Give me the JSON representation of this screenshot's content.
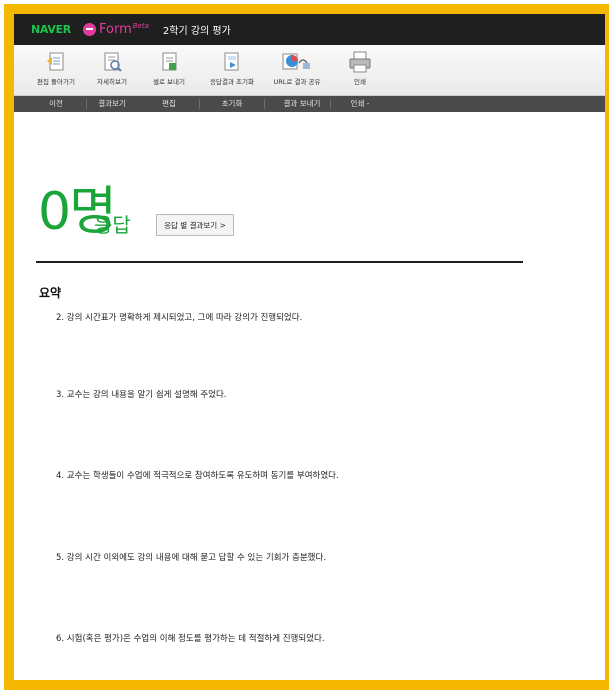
{
  "header": {
    "brand": "NAVER",
    "product": "Form",
    "product_beta": "Beta",
    "doc_title": "2학기 강의 평가"
  },
  "toolbar": {
    "tools": [
      {
        "label": "편집 돌아가기",
        "icon": "edit-back-icon"
      },
      {
        "label": "자세히보기",
        "icon": "detail-view-icon"
      },
      {
        "label": "셀로 보내기",
        "icon": "send-to-cell-icon"
      },
      {
        "label": "응답결과 초기화",
        "icon": "reset-results-icon"
      },
      {
        "label": "URL로 결과 공유",
        "icon": "share-url-icon"
      },
      {
        "label": "인쇄",
        "icon": "printer-icon"
      }
    ],
    "categories": [
      "이전",
      "결과보기",
      "편집",
      "초기화",
      "결과 보내기",
      "인쇄 -"
    ]
  },
  "summary": {
    "count": "0명",
    "count_unit": "응답",
    "results_by_response_button": "응답 별 결과보기 >",
    "title": "요약",
    "questions": [
      "2. 강의 시간표가 명확하게 제시되었고, 그에 따라 강의가 진행되었다.",
      "3. 교수는 강의 내용을 알기 쉽게 설명해 주었다.",
      "4. 교수는 학생들이 수업에 적극적으로 참여하도록 유도하며 동기를 부여하였다.",
      "5. 강의 시간 이외에도 강의 내용에 대해 묻고 답할 수 있는 기회가 충분했다.",
      "6. 시험(혹은 평가)은 수업의 이해 정도를 평가하는 데 적절하게 진행되었다."
    ]
  },
  "colors": {
    "frame": "#F5B800",
    "accent_green": "#1aa53a",
    "brand_green": "#19c44a",
    "form_pink": "#e33aa0"
  }
}
